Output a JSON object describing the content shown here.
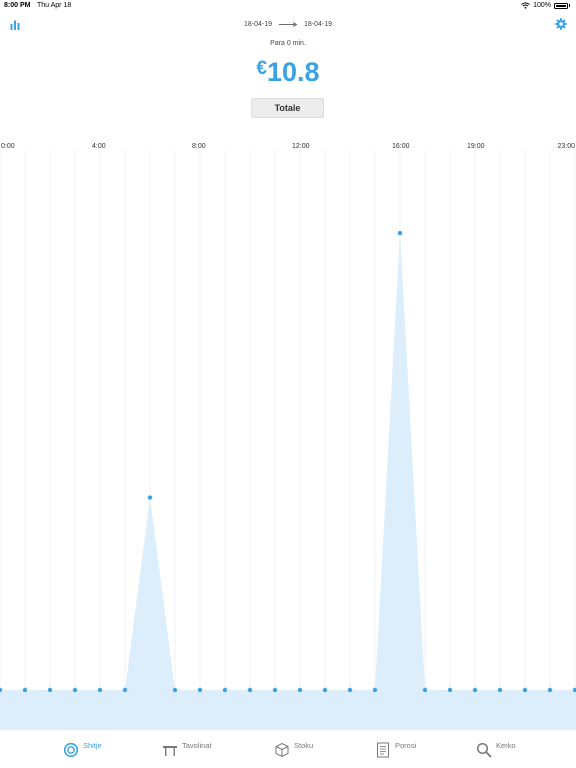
{
  "status_bar": {
    "time": "8:00 PM",
    "date": "Thu Apr 18",
    "battery": "100%",
    "battery_level": 1.0
  },
  "header": {
    "date_from": "18-04-19",
    "date_to": "18-04-19",
    "period": "Para 0 min."
  },
  "summary": {
    "currency": "€",
    "total": "10.8",
    "button_label": "Totale"
  },
  "icons": {
    "stats": "bar-chart-icon",
    "settings": "gear-icon",
    "wifi": "wifi-icon",
    "battery": "battery-icon",
    "arrow": "long-arrow-right-icon"
  },
  "colors": {
    "accent": "#3aa3e3",
    "area_fill": "#dceefb",
    "inactive_tab": "#777777"
  },
  "chart_data": {
    "type": "area",
    "x_tick_labels": [
      "0:00",
      "4:00",
      "8:00",
      "12:00",
      "16:00",
      "19:00",
      "23:00"
    ],
    "x": [
      0,
      1,
      2,
      3,
      4,
      5,
      6,
      7,
      8,
      9,
      10,
      11,
      12,
      13,
      14,
      15,
      16,
      17,
      18,
      19,
      20,
      21,
      22,
      23
    ],
    "values": [
      0,
      0,
      0,
      0,
      0,
      0,
      3.2,
      0,
      0,
      0,
      0,
      0,
      0,
      0,
      0,
      0,
      7.6,
      0,
      0,
      0,
      0,
      0,
      0,
      0
    ],
    "ylim": [
      0,
      8.1
    ],
    "grid": "vertical"
  },
  "tabs": [
    {
      "label": "Shitje",
      "icon": "target-icon",
      "active": true
    },
    {
      "label": "Tavolinat",
      "icon": "table-icon",
      "active": false
    },
    {
      "label": "Stoku",
      "icon": "box-icon",
      "active": false
    },
    {
      "label": "Porosi",
      "icon": "receipt-icon",
      "active": false
    },
    {
      "label": "Kerko",
      "icon": "search-icon",
      "active": false
    }
  ]
}
